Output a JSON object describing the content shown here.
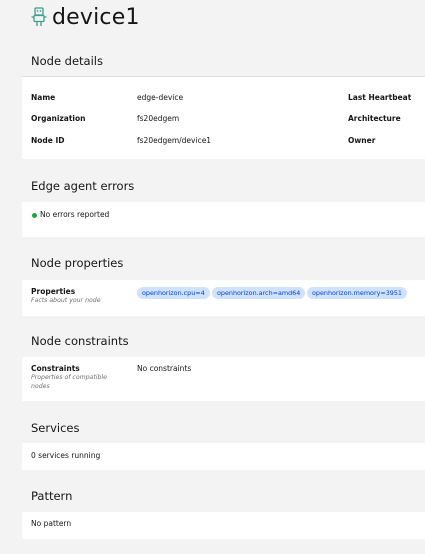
{
  "page": {
    "title": "device1",
    "icon": "device-robot-icon"
  },
  "node_details": {
    "heading": "Node details",
    "rows": [
      {
        "label": "Name",
        "value": "edge-device",
        "right_label": "Last Heartbeat"
      },
      {
        "label": "Organization",
        "value": "fs20edgem",
        "right_label": "Architecture"
      },
      {
        "label": "Node ID",
        "value": "fs20edgem/device1",
        "right_label": "Owner"
      }
    ]
  },
  "edge_agent_errors": {
    "heading": "Edge agent errors",
    "status_text": "No errors reported",
    "status_color": "#24a148"
  },
  "node_properties": {
    "heading": "Node properties",
    "label": "Properties",
    "sublabel": "Facts about your node",
    "tags": [
      "openhorizon.cpu=4",
      "openhorizon.arch=amd64",
      "openhorizon.memory=3951"
    ],
    "tag_bg": "#d0e2ff",
    "tag_text": "#0043ce"
  },
  "node_constraints": {
    "heading": "Node constraints",
    "label": "Constraints",
    "sublabel_line1": "Properties of compatible",
    "sublabel_line2": "nodes",
    "value": "No constraints"
  },
  "services": {
    "heading": "Services",
    "text": "0 services running"
  },
  "pattern": {
    "heading": "Pattern",
    "text": "No pattern"
  }
}
